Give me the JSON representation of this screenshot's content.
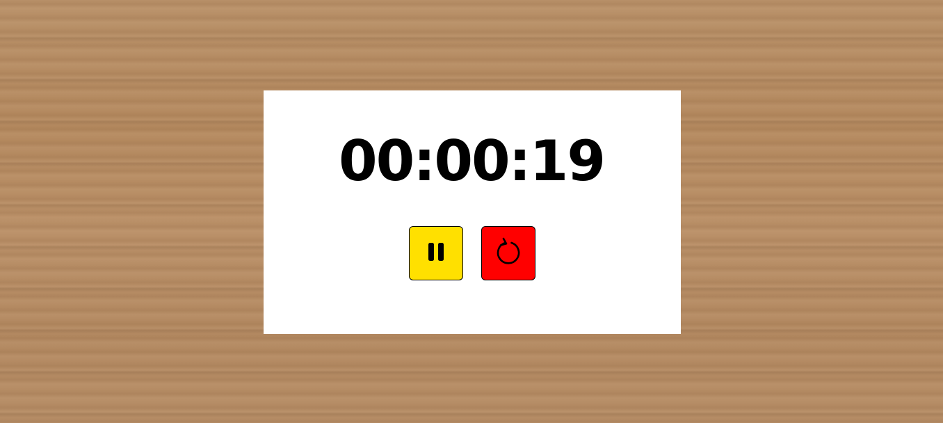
{
  "timer": {
    "display": "00:00:19"
  },
  "controls": {
    "pause": {
      "icon": "pause-icon",
      "color": "#FFE000"
    },
    "reset": {
      "icon": "reset-icon",
      "color": "#FF0000"
    }
  },
  "background": {
    "style": "wood-texture",
    "color": "#B78F68"
  },
  "panel": {
    "color": "#FFFFFF"
  }
}
